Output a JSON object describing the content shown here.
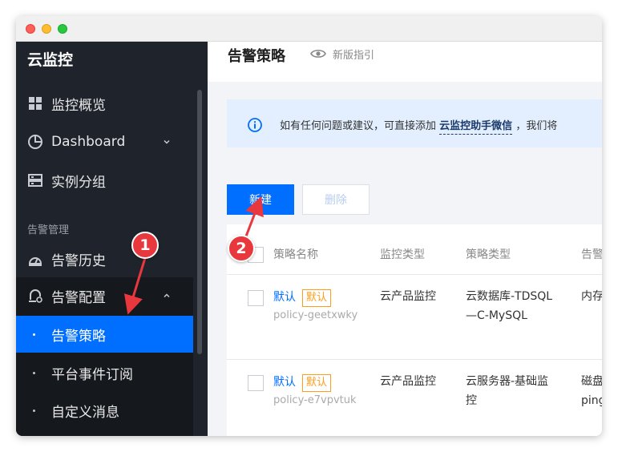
{
  "sidebar": {
    "brand": "云监控",
    "items": [
      {
        "label": "监控概览",
        "icon": "grid-icon"
      },
      {
        "label": "Dashboard",
        "icon": "pie-chart-icon"
      },
      {
        "label": "实例分组",
        "icon": "group-icon"
      }
    ],
    "section_title": "告警管理",
    "alarm_items": [
      {
        "label": "告警历史",
        "icon": "history-icon"
      },
      {
        "label": "告警配置",
        "icon": "alarm-config-icon"
      }
    ],
    "sub_items": [
      {
        "label": "告警策略",
        "active": true
      },
      {
        "label": "平台事件订阅",
        "active": false
      },
      {
        "label": "自定义消息",
        "active": false
      }
    ]
  },
  "header": {
    "title": "告警策略",
    "guide_label": "新版指引"
  },
  "notice": {
    "text_before": "如有任何问题或建议，可直接添加",
    "link": "云监控助手微信",
    "text_after": "，我们将"
  },
  "toolbar": {
    "create_label": "新建",
    "delete_label": "删除"
  },
  "table": {
    "columns": [
      "策略名称",
      "监控类型",
      "策略类型",
      "告警"
    ],
    "rows": [
      {
        "name": "默认",
        "badge": "默认",
        "id": "policy-geetxwky",
        "monitor_type": "云产品监控",
        "policy_type_line1": "云数据库-TDSQL",
        "policy_type_line2": "—C-MySQL",
        "alarm_line1": "内存",
        "alarm_line2": ""
      },
      {
        "name": "默认",
        "badge": "默认",
        "id": "policy-e7vpvtuk",
        "monitor_type": "云产品监控",
        "policy_type_line1": "云服务器-基础监",
        "policy_type_line2": "控",
        "alarm_line1": "磁盘",
        "alarm_line2": "ping"
      }
    ]
  },
  "callouts": {
    "one": "1",
    "two": "2"
  },
  "colors": {
    "sidebar_bg": "#1f232b",
    "accent": "#006eff",
    "badge": "#ff9c19",
    "callout": "#e8383d"
  }
}
